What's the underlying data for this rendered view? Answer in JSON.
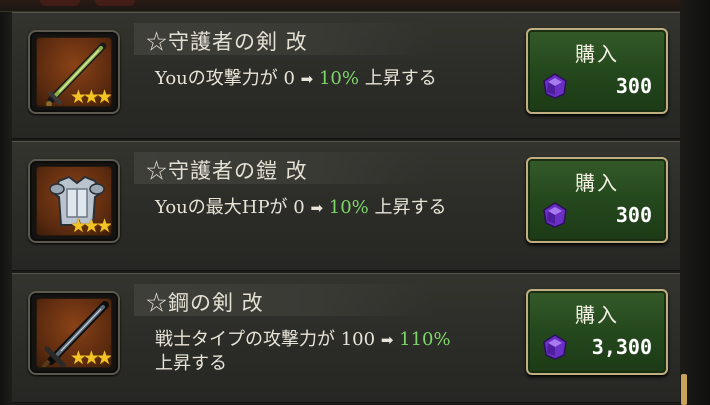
{
  "items": [
    {
      "name": "☆守護者の剣 改",
      "desc_prefix": "Youの攻撃力が 0 ",
      "desc_arrow": "➡",
      "desc_highlight": "10%",
      "desc_suffix": " 上昇する",
      "desc_line2": "",
      "stars": "★★★",
      "buy_label": "購入",
      "price": "300",
      "icon": "sword-icon"
    },
    {
      "name": "☆守護者の鎧 改",
      "desc_prefix": "Youの最大HPが 0 ",
      "desc_arrow": "➡",
      "desc_highlight": "10%",
      "desc_suffix": " 上昇する",
      "desc_line2": "",
      "stars": "★★★",
      "buy_label": "購入",
      "price": "300",
      "icon": "armor-icon"
    },
    {
      "name": "☆鋼の剣 改",
      "desc_prefix": "戦士タイプの攻撃力が 100 ",
      "desc_arrow": "➡",
      "desc_highlight": "110%",
      "desc_suffix": "",
      "desc_line2": "上昇する",
      "stars": "★★★",
      "buy_label": "購入",
      "price": "3,300",
      "icon": "steel-sword-icon"
    }
  ],
  "currency_icon": "purple-gem-icon",
  "colors": {
    "highlight": "#7ed66b",
    "buy_green": "#2a5021",
    "star": "#f2c425",
    "gem": "#7a3ad6"
  }
}
